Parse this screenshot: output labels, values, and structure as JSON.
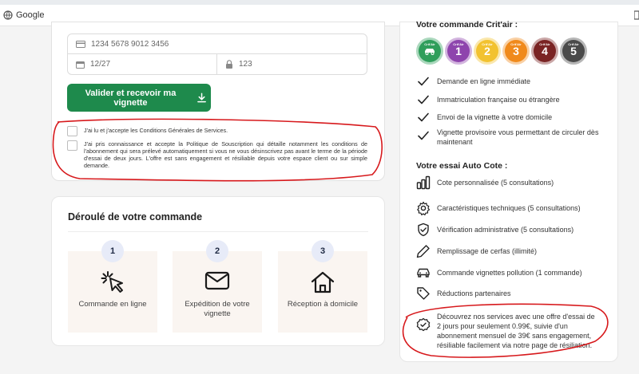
{
  "browser": {
    "bookmarks": [
      {
        "label": "Google",
        "icon": "globe-icon"
      }
    ]
  },
  "payment_form": {
    "card_number_placeholder": "1234 5678 9012 3456",
    "expiry_placeholder": "12/27",
    "cvc_placeholder": "123",
    "submit_label": "Valider et recevoir ma vignette",
    "accent_color": "#1e8a4c",
    "terms_checkbox_label": "J'ai lu et j'accepte les Conditions Générales de Services.",
    "subscription_checkbox_label": "J'ai pris connaissance et accepte la Politique de Souscription qui détaille notamment les conditions de l'abonnement qui sera prélevé automatiquement si vous ne vous désinscrivez pas avant le terme de la période d'essai de deux jours. L'offre est sans engagement et résiliable depuis votre espace client ou sur simple demande."
  },
  "order_steps": {
    "title": "Déroulé de votre commande",
    "steps": [
      {
        "number": "1",
        "label": "Commande en ligne",
        "icon": "click-icon"
      },
      {
        "number": "2",
        "label": "Expédition de votre vignette",
        "icon": "envelope-icon"
      },
      {
        "number": "3",
        "label": "Réception à domicile",
        "icon": "house-icon"
      }
    ]
  },
  "right_panel": {
    "order_heading": "Votre commande Crit'air :",
    "badges": [
      {
        "label": "Crit'Air",
        "value": "",
        "color": "#2f9e5b"
      },
      {
        "label": "Crit'Air",
        "value": "1",
        "color": "#8e44ad"
      },
      {
        "label": "Crit'Air",
        "value": "2",
        "color": "#f2c230"
      },
      {
        "label": "Crit'Air",
        "value": "3",
        "color": "#f08a1c"
      },
      {
        "label": "Crit'Air",
        "value": "4",
        "color": "#7a2424"
      },
      {
        "label": "Crit'Air",
        "value": "5",
        "color": "#4a4a4a"
      }
    ],
    "order_features": [
      "Demande en ligne immédiate",
      "Immatriculation française ou étrangère",
      "Envoi de la vignette à votre domicile",
      "Vignette provisoire vous permettant de circuler dès maintenant"
    ],
    "trial_heading": "Votre essai Auto Cote :",
    "trial_features": [
      {
        "text": "Cote personnalisée (5 consultations)",
        "icon": "bar-chart-icon"
      },
      {
        "text": "Caractéristiques techniques (5 consultations)",
        "icon": "gear-icon"
      },
      {
        "text": "Vérification administrative (5 consultations)",
        "icon": "shield-check-icon"
      },
      {
        "text": "Remplissage de cerfas (illimité)",
        "icon": "pencil-icon"
      },
      {
        "text": "Commande vignettes pollution (1 commande)",
        "icon": "car-icon"
      },
      {
        "text": "Réductions partenaires",
        "icon": "tag-icon"
      },
      {
        "text": "Découvrez nos services avec une offre d'essai de 2 jours pour seulement 0.99€, suivie d'un abonnement mensuel de 39€ sans engagement, résiliable facilement via notre page de résiliation.",
        "icon": "badge-check-icon"
      }
    ]
  },
  "annotation_color": "#d7191c"
}
